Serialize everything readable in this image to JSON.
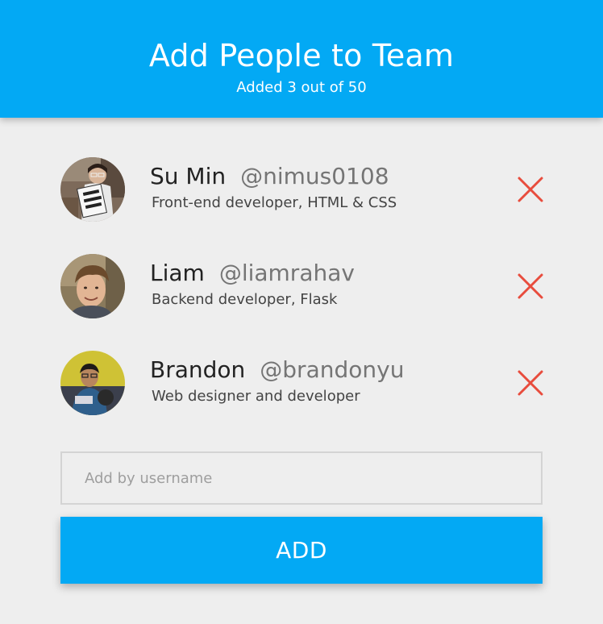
{
  "header": {
    "title": "Add People to Team",
    "subtitle": "Added 3 out of 50"
  },
  "members": [
    {
      "name": "Su Min",
      "username": "@nimus0108",
      "role": "Front-end developer, HTML & CSS",
      "avatar": "photo-person-holding-sign",
      "remove_icon": "close-icon"
    },
    {
      "name": "Liam",
      "username": "@liamrahav",
      "role": "Backend developer, Flask",
      "avatar": "photo-young-man",
      "remove_icon": "close-icon"
    },
    {
      "name": "Brandon",
      "username": "@brandonyu",
      "role": "Web designer and developer",
      "avatar": "photo-man-with-glasses",
      "remove_icon": "close-icon"
    }
  ],
  "add_form": {
    "placeholder": "Add by username",
    "value": "",
    "button_label": "ADD"
  },
  "colors": {
    "accent": "#03a9f4",
    "remove": "#e84c3d",
    "background": "#eeeeee"
  }
}
